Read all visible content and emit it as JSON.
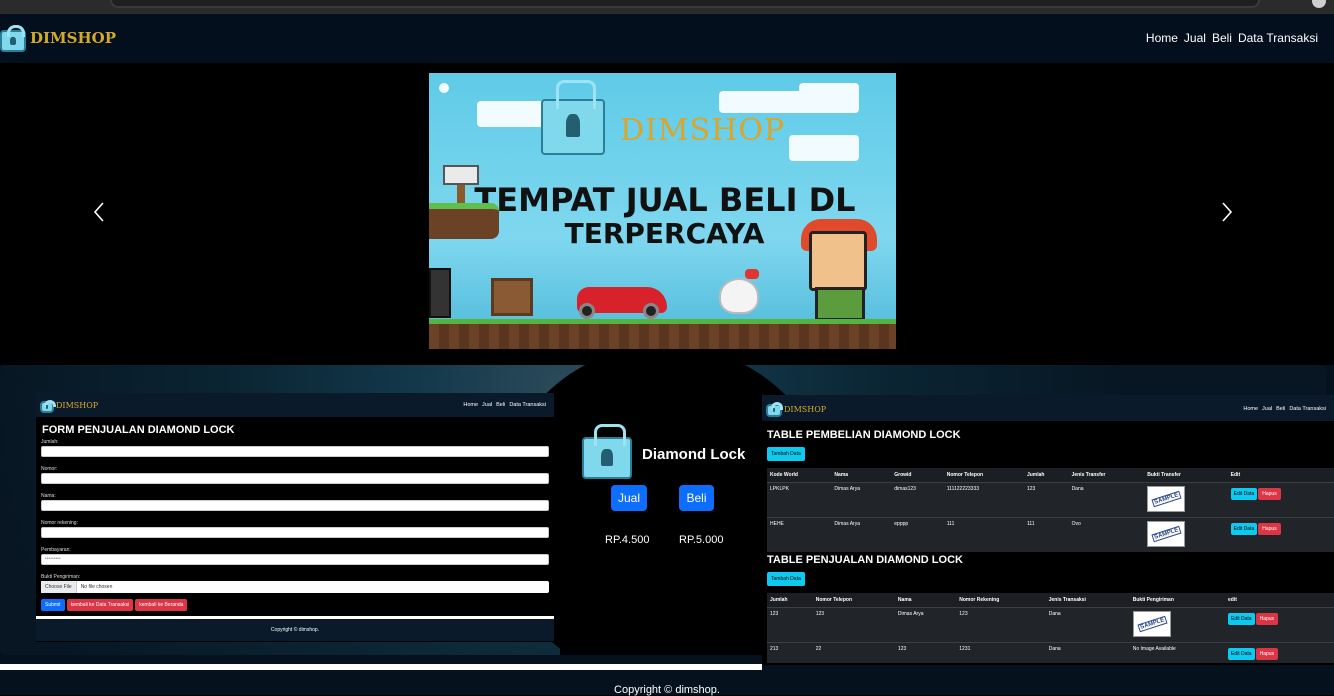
{
  "brand": {
    "name": "DIMSHOP"
  },
  "nav": {
    "items": [
      "Home",
      "Jual",
      "Beli",
      "Data Transaksi"
    ]
  },
  "banner": {
    "brand": "DIMSHOP",
    "line1": "TEMPAT JUAL BELI DL",
    "line2": "TERPERCAYA"
  },
  "form_page": {
    "brand": "DIMSHOP",
    "nav": [
      "Home",
      "Jual",
      "Beli",
      "Data Transaksi"
    ],
    "title": "FORM PENJUALAN DIAMOND LOCK",
    "fields": [
      {
        "label": "Jumlah:",
        "value": ""
      },
      {
        "label": "Nomor:",
        "value": ""
      },
      {
        "label": "Nama:",
        "value": ""
      },
      {
        "label": "Nomor rekening:",
        "value": ""
      },
      {
        "label": "Pembayaran:",
        "value": "•••••••••"
      },
      {
        "label": "Bukti Pengiriman:",
        "value": ""
      }
    ],
    "file_button": "Choose File",
    "file_status": "No file chosen",
    "buttons": [
      "Submit",
      "kembali ke Data Transaksi",
      "kembali ke Beranda"
    ],
    "footer": "Copyright © dimshop."
  },
  "product": {
    "title": "Diamond Lock",
    "buy_label": "Jual",
    "sell_label": "Beli",
    "price_jual": "RP.4.500",
    "price_beli": "RP.5.000"
  },
  "table_page": {
    "brand": "DIMSHOP",
    "nav": [
      "Home",
      "Jual",
      "Beli",
      "Data Transaksi"
    ],
    "pembelian": {
      "title": "TABLE PEMBELIAN DIAMOND LOCK",
      "add_label": "Tambah Data",
      "headers": [
        "Kode World",
        "Nama",
        "Growid",
        "Nomor Telepon",
        "Jumlah",
        "Jenis Transfer",
        "Bukti Transfer",
        "Edit"
      ],
      "rows": [
        [
          "LPKLPK",
          "Dimas Arya",
          "dimas123",
          "111122223333",
          "123",
          "Dana"
        ],
        [
          "HEHE",
          "Dimas Arya",
          "epppp",
          "111",
          "111",
          "Ovo"
        ]
      ]
    },
    "penjualan": {
      "title": "TABLE PENJUALAN DIAMOND LOCK",
      "add_label": "Tambah Data",
      "headers": [
        "Jumlah",
        "Nomor Telepon",
        "Nama",
        "Nomor Rekening",
        "Jenis Transaksi",
        "Bukti Pengiriman",
        "edit"
      ],
      "rows": [
        [
          "123",
          "123",
          "Dimas Arya",
          "123",
          "Dana"
        ],
        [
          "213",
          "22",
          "123",
          "1231",
          "Dana"
        ]
      ],
      "no_image": "No Image Available"
    },
    "sample_text": "SAMPLE",
    "edit_label": "Edit Data",
    "delete_label": "Hapus"
  },
  "footer": {
    "text": "Copyright © dimshop."
  },
  "colors": {
    "navbar": "#040f1e",
    "brand_gold": "#d4aa2a",
    "primary": "#0d6efd",
    "info": "#0dcaf0",
    "danger": "#dc3545"
  }
}
